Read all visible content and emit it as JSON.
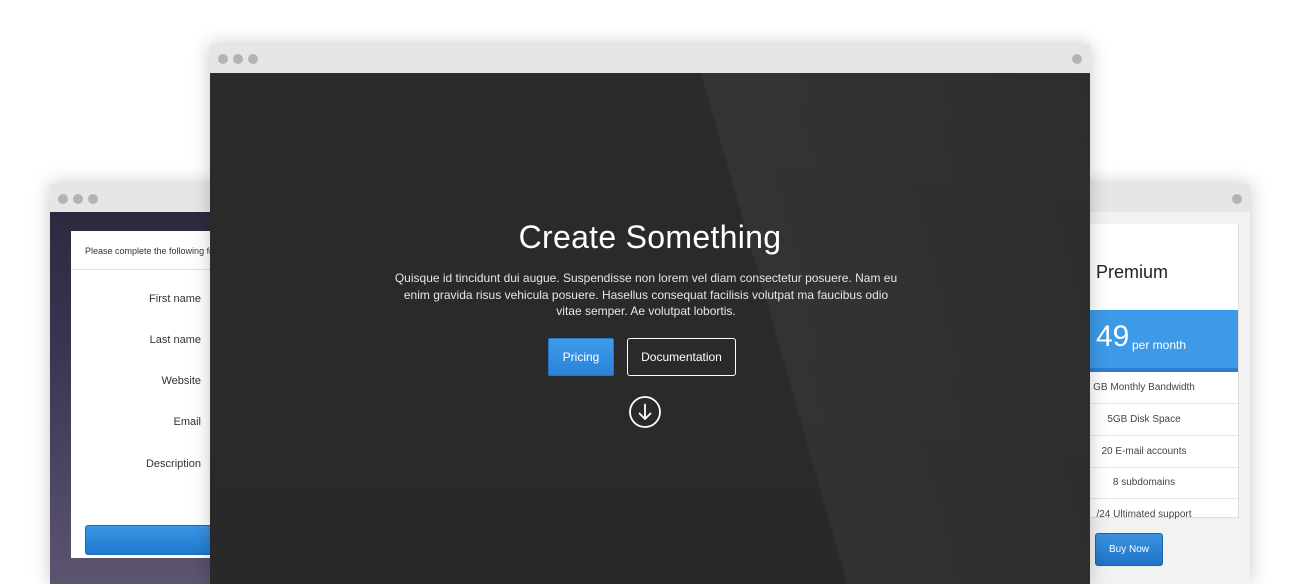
{
  "form_window": {
    "intro": "Please complete the following fo",
    "fields": [
      {
        "label": "First name"
      },
      {
        "label": "Last name"
      },
      {
        "label": "Website"
      },
      {
        "label": "Email"
      },
      {
        "label": "Description"
      }
    ],
    "field_icon": "circle-arrow-icon"
  },
  "hero_window": {
    "title": "Create Something",
    "description": "Quisque id tincidunt dui augue. Suspendisse non lorem vel diam consectetur posuere. Nam eu enim gravida risus vehicula posuere. Hasellus consequat facilisis volutpat ma faucibus odio vitae semper. Ae volutpat lobortis.",
    "buttons": {
      "pricing": "Pricing",
      "documentation": "Documentation"
    },
    "scroll_icon": "arrow-down-circle-icon"
  },
  "pricing_window": {
    "plan": "Premium",
    "price": "49",
    "period": "per month",
    "features": [
      "GB Monthly Bandwidth",
      "5GB Disk Space",
      "20 E-mail accounts",
      "8 subdomains",
      "/24 Ultimated support"
    ],
    "buy_label": "Buy Now"
  },
  "colors": {
    "accent": "#3d9ae8",
    "hero_bg": "#2a2a2a",
    "titlebar": "#e6e6e6"
  }
}
